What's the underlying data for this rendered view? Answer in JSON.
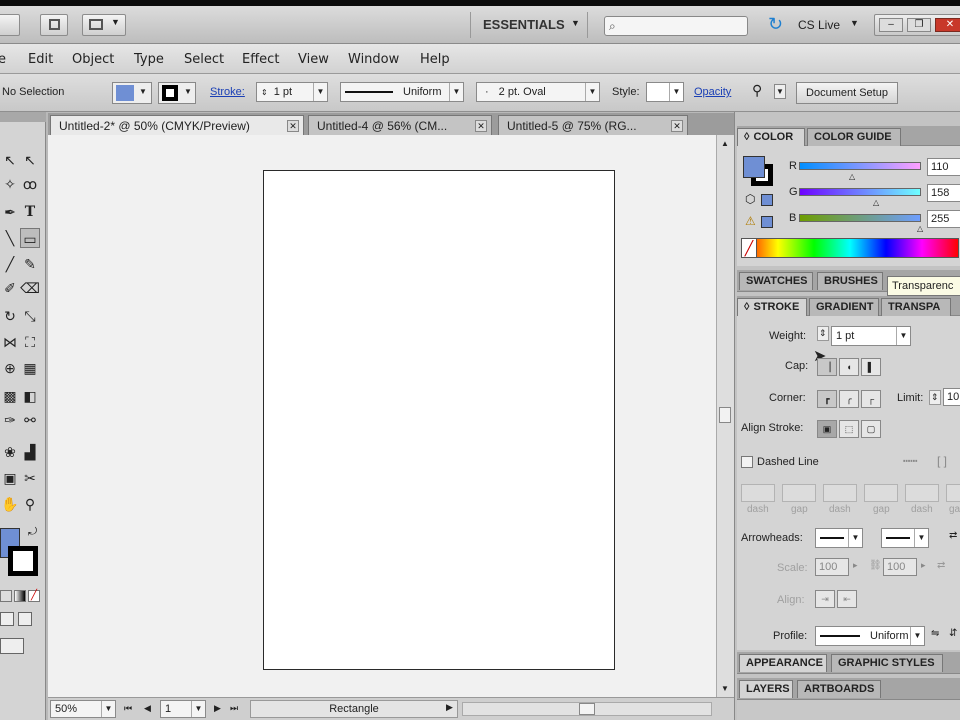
{
  "topbar": {
    "workspace": "ESSENTIALS",
    "cslive": "CS Live",
    "search_placeholder": ""
  },
  "menu": [
    "e",
    "Edit",
    "Object",
    "Type",
    "Select",
    "Effect",
    "View",
    "Window",
    "Help"
  ],
  "control": {
    "selection": "No Selection",
    "stroke_label": "Stroke:",
    "stroke_weight": "1 pt",
    "profile": "Uniform",
    "brush": "2 pt. Oval",
    "style_label": "Style:",
    "opacity_label": "Opacity",
    "doc_setup": "Document Setup"
  },
  "tabs": [
    {
      "label": "Untitled-2* @ 50% (CMYK/Preview)",
      "active": true
    },
    {
      "label": "Untitled-4 @ 56% (CM...",
      "active": false
    },
    {
      "label": "Untitled-5 @ 75% (RG...",
      "active": false
    }
  ],
  "status": {
    "zoom": "50%",
    "page": "1",
    "tool": "Rectangle"
  },
  "color_panel": {
    "tab_color": "COLOR",
    "tab_guide": "COLOR GUIDE",
    "fill_color": "#6f8fd4",
    "r_label": "R",
    "r": "110",
    "g_label": "G",
    "g": "158",
    "b_label": "B",
    "b": "255"
  },
  "swatch_row": {
    "swatches": "SWATCHES",
    "brushes": "BRUSHES",
    "tooltip": "Transparenc"
  },
  "stroke_panel": {
    "tab_stroke": "STROKE",
    "tab_gradient": "GRADIENT",
    "tab_transp": "TRANSPA",
    "weight_label": "Weight:",
    "weight": "1 pt",
    "cap_label": "Cap:",
    "corner_label": "Corner:",
    "limit_label": "Limit:",
    "limit": "10",
    "align_label": "Align Stroke:",
    "dashed_label": "Dashed Line",
    "dash_labels": [
      "dash",
      "gap",
      "dash",
      "gap",
      "dash",
      "gap"
    ],
    "arrowheads_label": "Arrowheads:",
    "scale_label": "Scale:",
    "scale1": "100",
    "scale2": "100",
    "align2_label": "Align:",
    "profile_label": "Profile:",
    "profile": "Uniform"
  },
  "bottom_panels": {
    "appearance": "APPEARANCE",
    "graphic_styles": "GRAPHIC STYLES",
    "layers": "LAYERS",
    "artboards": "ARTBOARDS"
  }
}
